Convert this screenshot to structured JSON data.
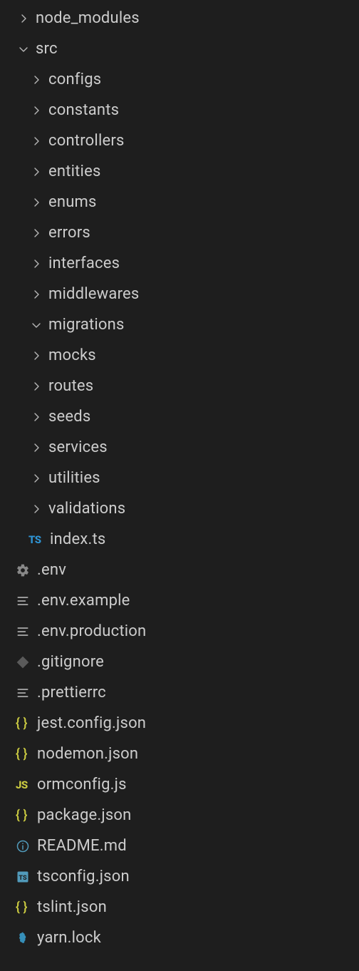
{
  "tree": [
    {
      "label": "node_modules",
      "type": "folder",
      "state": "collapsed",
      "indent": 0
    },
    {
      "label": "src",
      "type": "folder",
      "state": "expanded",
      "indent": 0
    },
    {
      "label": "configs",
      "type": "folder",
      "state": "collapsed",
      "indent": 1
    },
    {
      "label": "constants",
      "type": "folder",
      "state": "collapsed",
      "indent": 1
    },
    {
      "label": "controllers",
      "type": "folder",
      "state": "collapsed",
      "indent": 1
    },
    {
      "label": "entities",
      "type": "folder",
      "state": "collapsed",
      "indent": 1
    },
    {
      "label": "enums",
      "type": "folder",
      "state": "collapsed",
      "indent": 1
    },
    {
      "label": "errors",
      "type": "folder",
      "state": "collapsed",
      "indent": 1
    },
    {
      "label": "interfaces",
      "type": "folder",
      "state": "collapsed",
      "indent": 1
    },
    {
      "label": "middlewares",
      "type": "folder",
      "state": "collapsed",
      "indent": 1
    },
    {
      "label": "migrations",
      "type": "folder",
      "state": "expanded",
      "indent": 1
    },
    {
      "label": "mocks",
      "type": "folder",
      "state": "collapsed",
      "indent": 1
    },
    {
      "label": "routes",
      "type": "folder",
      "state": "collapsed",
      "indent": 1
    },
    {
      "label": "seeds",
      "type": "folder",
      "state": "collapsed",
      "indent": 1
    },
    {
      "label": "services",
      "type": "folder",
      "state": "collapsed",
      "indent": 1
    },
    {
      "label": "utilities",
      "type": "folder",
      "state": "collapsed",
      "indent": 1
    },
    {
      "label": "validations",
      "type": "folder",
      "state": "collapsed",
      "indent": 1
    },
    {
      "label": "index.ts",
      "type": "file",
      "icon": "ts",
      "indent": 2
    },
    {
      "label": ".env",
      "type": "file",
      "icon": "gear",
      "indent": 0
    },
    {
      "label": ".env.example",
      "type": "file",
      "icon": "lines",
      "indent": 0
    },
    {
      "label": ".env.production",
      "type": "file",
      "icon": "lines",
      "indent": 0
    },
    {
      "label": ".gitignore",
      "type": "file",
      "icon": "git",
      "indent": 0
    },
    {
      "label": ".prettierrc",
      "type": "file",
      "icon": "lines",
      "indent": 0
    },
    {
      "label": "jest.config.json",
      "type": "file",
      "icon": "json",
      "indent": 0
    },
    {
      "label": "nodemon.json",
      "type": "file",
      "icon": "json",
      "indent": 0
    },
    {
      "label": "ormconfig.js",
      "type": "file",
      "icon": "js",
      "indent": 0
    },
    {
      "label": "package.json",
      "type": "file",
      "icon": "json",
      "indent": 0
    },
    {
      "label": "README.md",
      "type": "file",
      "icon": "info",
      "indent": 0
    },
    {
      "label": "tsconfig.json",
      "type": "file",
      "icon": "tsconfig",
      "indent": 0
    },
    {
      "label": "tslint.json",
      "type": "file",
      "icon": "json",
      "indent": 0
    },
    {
      "label": "yarn.lock",
      "type": "file",
      "icon": "yarn",
      "indent": 0
    }
  ],
  "iconText": {
    "ts": "TS",
    "js": "JS",
    "json": "{ }",
    "tsconfig": "TS"
  }
}
